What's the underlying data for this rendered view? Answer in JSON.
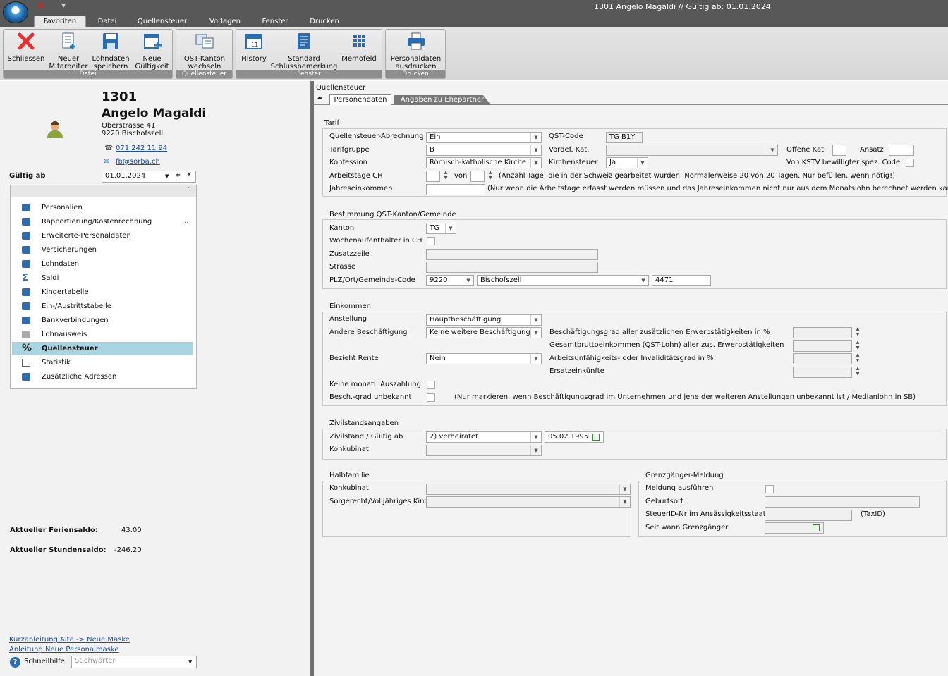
{
  "window": {
    "title": "1301 Angelo Magaldi // Gültig ab: 01.01.2024"
  },
  "tabs": [
    "Favoriten",
    "Datei",
    "Quellensteuer",
    "Vorlagen",
    "Fenster",
    "Drucken"
  ],
  "ribbon": {
    "groups": [
      {
        "label": "Datei",
        "buttons": [
          "Schliessen",
          "Neuer Mitarbeiter",
          "Lohndaten speichern",
          "Neue Gültigkeit"
        ]
      },
      {
        "label": "Quellensteuer",
        "buttons": [
          "QST-Kanton wechseln"
        ]
      },
      {
        "label": "Fenster",
        "buttons": [
          "History",
          "Standard Schlussbemerkung",
          "Memofeld"
        ]
      },
      {
        "label": "Drucken",
        "buttons": [
          "Personaldaten ausdrucken"
        ]
      }
    ]
  },
  "employee": {
    "number": "1301",
    "name": "Angelo Magaldi",
    "street": "Oberstrasse 41",
    "city": "9220 Bischofszell",
    "phone": "071 242 11 94",
    "email": "fb@sorba.ch"
  },
  "valid_from": {
    "label": "Gültig ab",
    "value": "01.01.2024"
  },
  "nav": [
    "Personalien",
    "Rapportierung/Kostenrechnung",
    "Erweiterte-Personaldaten",
    "Versicherungen",
    "Lohndaten",
    "Saldi",
    "Kindertabelle",
    "Ein-/Austrittstabelle",
    "Bankverbindungen",
    "Lohnausweis",
    "Quellensteuer",
    "Statistik",
    "Zusätzliche Adressen"
  ],
  "nav_more": "...",
  "balances": [
    {
      "label": "Aktueller Feriensaldo:",
      "value": "43.00"
    },
    {
      "label": "Aktueller Stundensaldo:",
      "value": "-246.20"
    }
  ],
  "help_links": [
    "Kurzanleitung Alte -> Neue Maske",
    "Anleitung Neue Personalmaske"
  ],
  "quickhelp": {
    "label": "Schnellhilfe",
    "placeholder": "Stichwörter"
  },
  "panel": {
    "title": "Quellensteuer",
    "subtabs": [
      "Personendaten",
      "Angaben zu Ehepartner"
    ]
  },
  "tarif": {
    "section": "Tarif",
    "qst_abrechnung": {
      "label": "Quellensteuer-Abrechnung",
      "value": "Ein"
    },
    "tarifgruppe": {
      "label": "Tarifgruppe",
      "value": "B"
    },
    "konfession": {
      "label": "Konfession",
      "value": "Römisch-katholische Kirche"
    },
    "arbeitstage": {
      "label": "Arbeitstage CH",
      "von": "von",
      "note": "(Anzahl Tage, die in der Schweiz gearbeitet wurden. Normalerweise 20 von 20 Tagen. Nur befüllen, wenn nötig!)"
    },
    "jahreseinkommen": {
      "label": "Jahreseinkommen",
      "note": "(Nur wenn die Arbeitstage erfasst werden müssen und das Jahreseinkommen nicht nur aus dem Monatslohn berechnet werden kann)"
    },
    "qst_code": {
      "label": "QST-Code",
      "value": "TG B1Y"
    },
    "vordef_kat": {
      "label": "Vordef. Kat."
    },
    "offene_kat": {
      "label": "Offene Kat."
    },
    "ansatz": {
      "label": "Ansatz"
    },
    "kirchensteuer": {
      "label": "Kirchensteuer",
      "value": "Ja"
    },
    "kstv": {
      "label": "Von KSTV bewilligter spez. Code"
    }
  },
  "bestimmung": {
    "section": "Bestimmung QST-Kanton/Gemeinde",
    "kanton": {
      "label": "Kanton",
      "value": "TG"
    },
    "wochenaufenthalter": {
      "label": "Wochenaufenthalter in CH"
    },
    "zusatzzeile": {
      "label": "Zusatzzeile"
    },
    "strasse": {
      "label": "Strasse"
    },
    "plz": {
      "label": "PLZ/Ort/Gemeinde-Code",
      "plz": "9220",
      "ort": "Bischofszell",
      "code": "4471"
    }
  },
  "einkommen": {
    "section": "Einkommen",
    "anstellung": {
      "label": "Anstellung",
      "value": "Hauptbeschäftigung"
    },
    "andere": {
      "label": "Andere Beschäftigung",
      "value": "Keine weitere Beschäftigung"
    },
    "rente": {
      "label": "Bezieht Rente",
      "value": "Nein"
    },
    "grad": "Beschäftigungsgrad aller zusätzlichen Erwerbstätigkeiten in %",
    "gesamt": "Gesamtbruttoeinkommen (QST-Lohn) aller zus. Erwerbstätigkeiten",
    "iv": "Arbeitsunfähigkeits- oder Invaliditätsgrad in %",
    "ersatz": "Ersatzeinkünfte",
    "keine": {
      "label": "Keine monatl. Auszahlung"
    },
    "besch": {
      "label": "Besch.-grad unbekannt",
      "note": "(Nur markieren, wenn Beschäftigungsgrad im Unternehmen und jene der weiteren Anstellungen unbekannt ist  / Medianlohn in SB)"
    }
  },
  "zivil": {
    "section": "Zivilstandsangaben",
    "zivilstand": {
      "label": "Zivilstand / Gültig ab",
      "value": "2) verheiratet",
      "date": "05.02.1995"
    },
    "konkubinat": {
      "label": "Konkubinat"
    }
  },
  "halbfamilie": {
    "section": "Halbfamilie",
    "konkubinat": "Konkubinat",
    "sorgerecht": "Sorgerecht/Volljähriges Kind"
  },
  "grenz": {
    "section": "Grenzgänger-Meldung",
    "meldung": "Meldung ausführen",
    "geburtsort": "Geburtsort",
    "steuerid": "SteuerID-Nr im Ansässigkeitsstaat",
    "taxid": "(TaxID)",
    "seit": "Seit wann Grenzgänger"
  },
  "colors": {
    "accent": "#a9d5e3",
    "titlebar": "#585858",
    "link": "#1a4fb0"
  }
}
